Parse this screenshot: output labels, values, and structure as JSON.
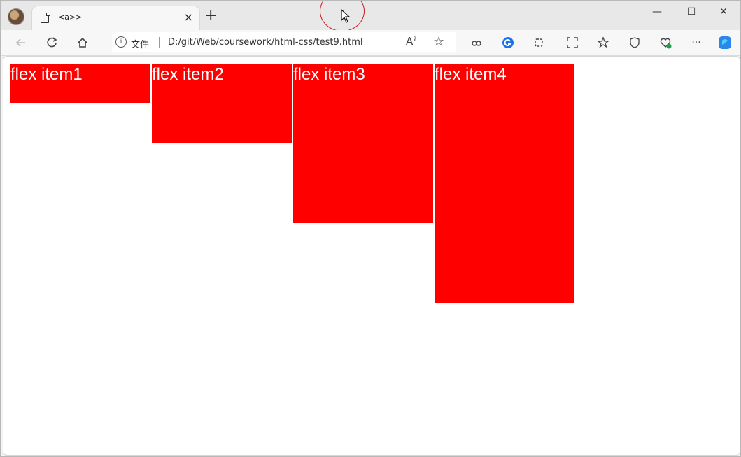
{
  "browser": {
    "tab_title": "<a>>",
    "tab_close": "×",
    "new_tab": "+",
    "address_info": "i",
    "address_label": "文件",
    "url": "D:/git/Web/coursework/html-css/test9.html",
    "read_aloud": "Aˀ",
    "favorite": "☆",
    "window_controls": {
      "minimize": "—",
      "maximize": "☐",
      "close": "✕"
    },
    "toolbar_icons": [
      "back-icon",
      "refresh-icon",
      "home-icon",
      "split-screen-icon",
      "google-icon",
      "extensions-icon",
      "screenshot-icon",
      "favorites-icon",
      "browser-essentials-icon",
      "health-icon",
      "more-icon",
      "copilot-icon"
    ]
  },
  "page": {
    "items": [
      {
        "label": "flex item1"
      },
      {
        "label": "flex item2"
      },
      {
        "label": "flex item3"
      },
      {
        "label": "flex item4"
      }
    ],
    "item_color": "#ff0000"
  }
}
